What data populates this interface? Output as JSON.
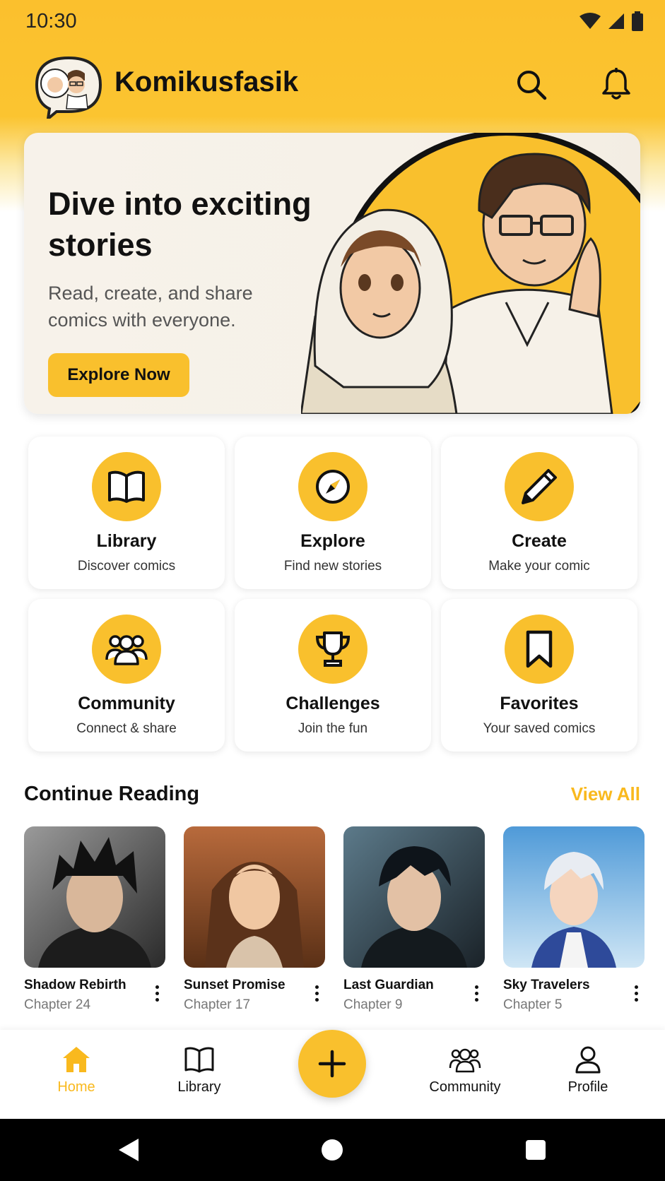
{
  "status_bar": {
    "time": "10:30"
  },
  "header": {
    "app_title": "Komikusfasik"
  },
  "hero": {
    "title": "Dive into exciting stories",
    "subtitle": "Read, create, and share comics with everyone.",
    "button_label": "Explore Now"
  },
  "features": [
    {
      "title": "Library",
      "subtitle": "Discover comics",
      "icon": "book-icon"
    },
    {
      "title": "Explore",
      "subtitle": "Find new stories",
      "icon": "compass-icon"
    },
    {
      "title": "Create",
      "subtitle": "Make your comic",
      "icon": "pencil-icon"
    },
    {
      "title": "Community",
      "subtitle": "Connect & share",
      "icon": "people-icon"
    },
    {
      "title": "Challenges",
      "subtitle": "Join the fun",
      "icon": "trophy-icon"
    },
    {
      "title": "Favorites",
      "subtitle": "Your saved comics",
      "icon": "bookmark-icon"
    }
  ],
  "continue_reading": {
    "title": "Continue Reading",
    "view_all": "View All",
    "items": [
      {
        "name": "Shadow Rebirth",
        "chapter": "Chapter 24"
      },
      {
        "name": "Sunset Promise",
        "chapter": "Chapter 17"
      },
      {
        "name": "Last Guardian",
        "chapter": "Chapter 9"
      },
      {
        "name": "Sky Travelers",
        "chapter": "Chapter 5"
      }
    ]
  },
  "bottom_nav": {
    "home": "Home",
    "library": "Library",
    "community": "Community",
    "profile": "Profile"
  },
  "colors": {
    "accent": "#F9C02D",
    "accent_text": "#F9B91E"
  }
}
